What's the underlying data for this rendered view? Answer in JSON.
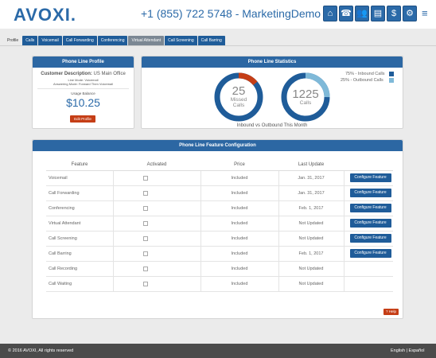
{
  "header": {
    "logo": "AVOXI.",
    "phone": "+1 (855) 722 5748 - MarketingDemo",
    "icons": [
      "home-icon",
      "phone-icon",
      "users-icon",
      "report-icon",
      "billing-icon",
      "user-settings-icon"
    ],
    "icon_glyphs": [
      "⌂",
      "☎",
      "👥",
      "▤",
      "$",
      "⚙"
    ],
    "menu_glyph": "≡"
  },
  "tabs": [
    {
      "label": "Profile",
      "style": "plain"
    },
    {
      "label": "Calls",
      "style": "blue"
    },
    {
      "label": "Voicemail",
      "style": "blue"
    },
    {
      "label": "Call Forwarding",
      "style": "blue"
    },
    {
      "label": "Conferencing",
      "style": "blue"
    },
    {
      "label": "Virtual Attendant",
      "style": "active"
    },
    {
      "label": "Call Screening",
      "style": "blue"
    },
    {
      "label": "Call Barring",
      "style": "blue"
    }
  ],
  "profile": {
    "title": "Phone Line Profile",
    "customer_label": "Customer Description:",
    "customer_value": "US Main Office",
    "line_mode_label": "Line Mode:",
    "line_mode_value": "Voicemail",
    "answering_label": "Answering Mode:",
    "answering_value": "Forward Then Voicemail",
    "usage_label": "Usage Balance",
    "usage_value": "$10.25",
    "edit_label": "Edit Profile"
  },
  "stats": {
    "title": "Phone Line Statistics",
    "missed_value": "25",
    "missed_label_1": "Missed",
    "missed_label_2": "Calls",
    "missed_fraction": 0.14,
    "calls_value": "1225",
    "calls_label": "Calls",
    "calls_fraction": 0.25,
    "caption": "Inbound vs Outbound This Month",
    "legend_inbound": "75% - Inbound Calls",
    "legend_outbound": "25% - Outbound Calls",
    "colors": {
      "inbound": "#1f5c99",
      "outbound": "#7fb9d8",
      "missed": "#c53e16"
    }
  },
  "features": {
    "title": "Phone Line Feature Configuration",
    "headers": {
      "feature": "Feature",
      "activated": "Activated",
      "price": "Price",
      "last_update": "Last Update"
    },
    "rows": [
      {
        "name": "Voicemail",
        "price": "Included",
        "date": "Jan. 31, 2017",
        "button": "Configure Feature"
      },
      {
        "name": "Call Forwarding",
        "price": "Included",
        "date": "Jan. 31, 2017",
        "button": "Configure Feature"
      },
      {
        "name": "Conferencing",
        "price": "Included",
        "date": "Feb. 1, 2017",
        "button": "Configure Feature"
      },
      {
        "name": "Virtual Attendant",
        "price": "Included",
        "date": "Not Updated",
        "button": "Configure Feature"
      },
      {
        "name": "Call Screening",
        "price": "Included",
        "date": "Not Updated",
        "button": "Configure Feature"
      },
      {
        "name": "Call Barring",
        "price": "Included",
        "date": "Feb. 1, 2017",
        "button": "Configure Feature"
      },
      {
        "name": "Call Recording",
        "price": "Included",
        "date": "Not Updated",
        "button": ""
      },
      {
        "name": "Call Waiting",
        "price": "Included",
        "date": "Not Updated",
        "button": ""
      }
    ],
    "help_label": "? Help"
  },
  "footer": {
    "copyright": "© 2016 AVOXI, All rights reserved",
    "lang_en": "English",
    "lang_sep": "|",
    "lang_es": "Español"
  }
}
